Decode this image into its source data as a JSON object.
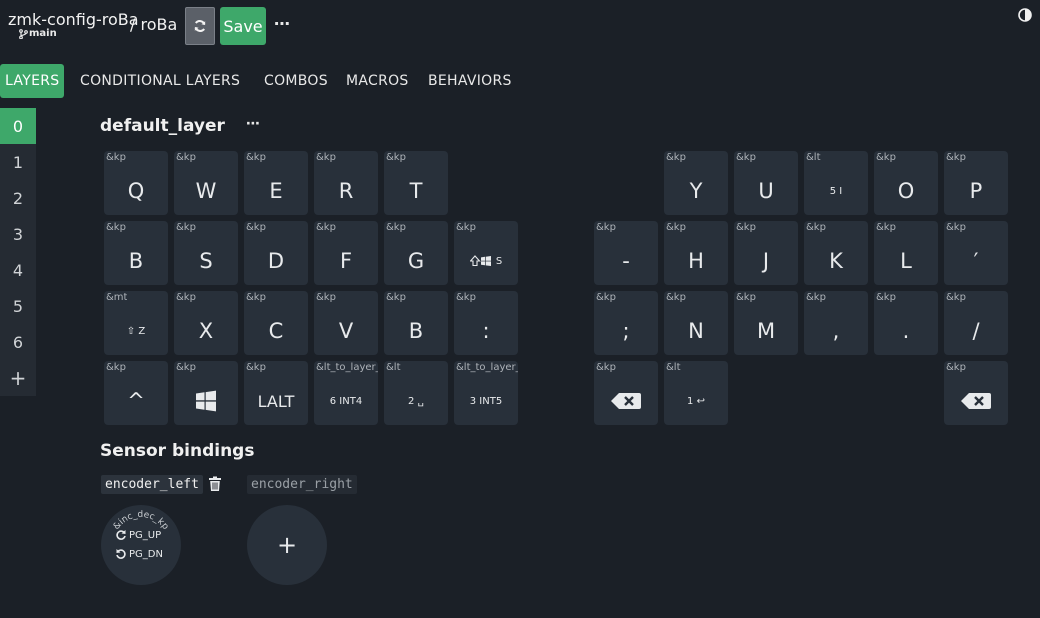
{
  "header": {
    "repo": "zmk-config-roBa",
    "branch": "main",
    "separator_layout": "/ roBa",
    "refresh_icon": "refresh-icon",
    "save_label": "Save",
    "more_label": "⋯",
    "theme_icon": "contrast-icon"
  },
  "tabs": [
    {
      "label": "LAYERS",
      "active": true
    },
    {
      "label": "CONDITIONAL LAYERS"
    },
    {
      "label": "COMBOS"
    },
    {
      "label": "MACROS"
    },
    {
      "label": "BEHAVIORS"
    }
  ],
  "layers": {
    "items": [
      "0",
      "1",
      "2",
      "3",
      "4",
      "5",
      "6"
    ],
    "active": "0",
    "add_label": "+"
  },
  "keymap": {
    "layer_title": "default_layer",
    "layer_more": "⋯",
    "keys": [
      {
        "bh": "&kp",
        "label": "Q"
      },
      {
        "bh": "&kp",
        "label": "W"
      },
      {
        "bh": "&kp",
        "label": "E"
      },
      {
        "bh": "&kp",
        "label": "R"
      },
      {
        "bh": "&kp",
        "label": "T"
      },
      {
        "bh": "&kp",
        "label": "Y"
      },
      {
        "bh": "&kp",
        "label": "U"
      },
      {
        "bh": "&lt",
        "label": "5 I"
      },
      {
        "bh": "&kp",
        "label": "O"
      },
      {
        "bh": "&kp",
        "label": "P"
      },
      {
        "bh": "&kp",
        "label": "B"
      },
      {
        "bh": "&kp",
        "label": "S"
      },
      {
        "bh": "&kp",
        "label": "D"
      },
      {
        "bh": "&kp",
        "label": "F"
      },
      {
        "bh": "&kp",
        "label": "G"
      },
      {
        "bh": "&kp",
        "label": "S",
        "icon": "shift-win-icon"
      },
      {
        "bh": "&kp",
        "label": "-"
      },
      {
        "bh": "&kp",
        "label": "H"
      },
      {
        "bh": "&kp",
        "label": "J"
      },
      {
        "bh": "&kp",
        "label": "K"
      },
      {
        "bh": "&kp",
        "label": "L"
      },
      {
        "bh": "&kp",
        "label": "′"
      },
      {
        "bh": "&mt",
        "label": "⇧ Z"
      },
      {
        "bh": "&kp",
        "label": "X"
      },
      {
        "bh": "&kp",
        "label": "C"
      },
      {
        "bh": "&kp",
        "label": "V"
      },
      {
        "bh": "&kp",
        "label": "B"
      },
      {
        "bh": "&kp",
        "label": ":"
      },
      {
        "bh": "&kp",
        "label": ";"
      },
      {
        "bh": "&kp",
        "label": "N"
      },
      {
        "bh": "&kp",
        "label": "M"
      },
      {
        "bh": "&kp",
        "label": ","
      },
      {
        "bh": "&kp",
        "label": "."
      },
      {
        "bh": "&kp",
        "label": "/"
      },
      {
        "bh": "&kp",
        "label": "^"
      },
      {
        "bh": "&kp",
        "label": "",
        "icon": "windows-icon"
      },
      {
        "bh": "&kp",
        "label": "LALT"
      },
      {
        "bh": "&lt_to_layer_0",
        "label": "6 INT4"
      },
      {
        "bh": "&lt",
        "label": "2 ␣"
      },
      {
        "bh": "&lt_to_layer_0",
        "label": "3 INT5"
      },
      {
        "bh": "&kp",
        "label": "",
        "icon": "backspace-icon"
      },
      {
        "bh": "&lt",
        "label": "1 ↩"
      },
      {
        "bh": "&kp",
        "label": "",
        "icon": "backspace-icon"
      }
    ]
  },
  "sensors": {
    "title": "Sensor bindings",
    "encoder_left": "encoder_left",
    "encoder_right": "encoder_right",
    "encoder_behavior": "&inc_dec_kp",
    "cw_label": "PG_UP",
    "ccw_label": "PG_DN",
    "add_label": "+",
    "trash_icon": "trash-icon"
  }
}
